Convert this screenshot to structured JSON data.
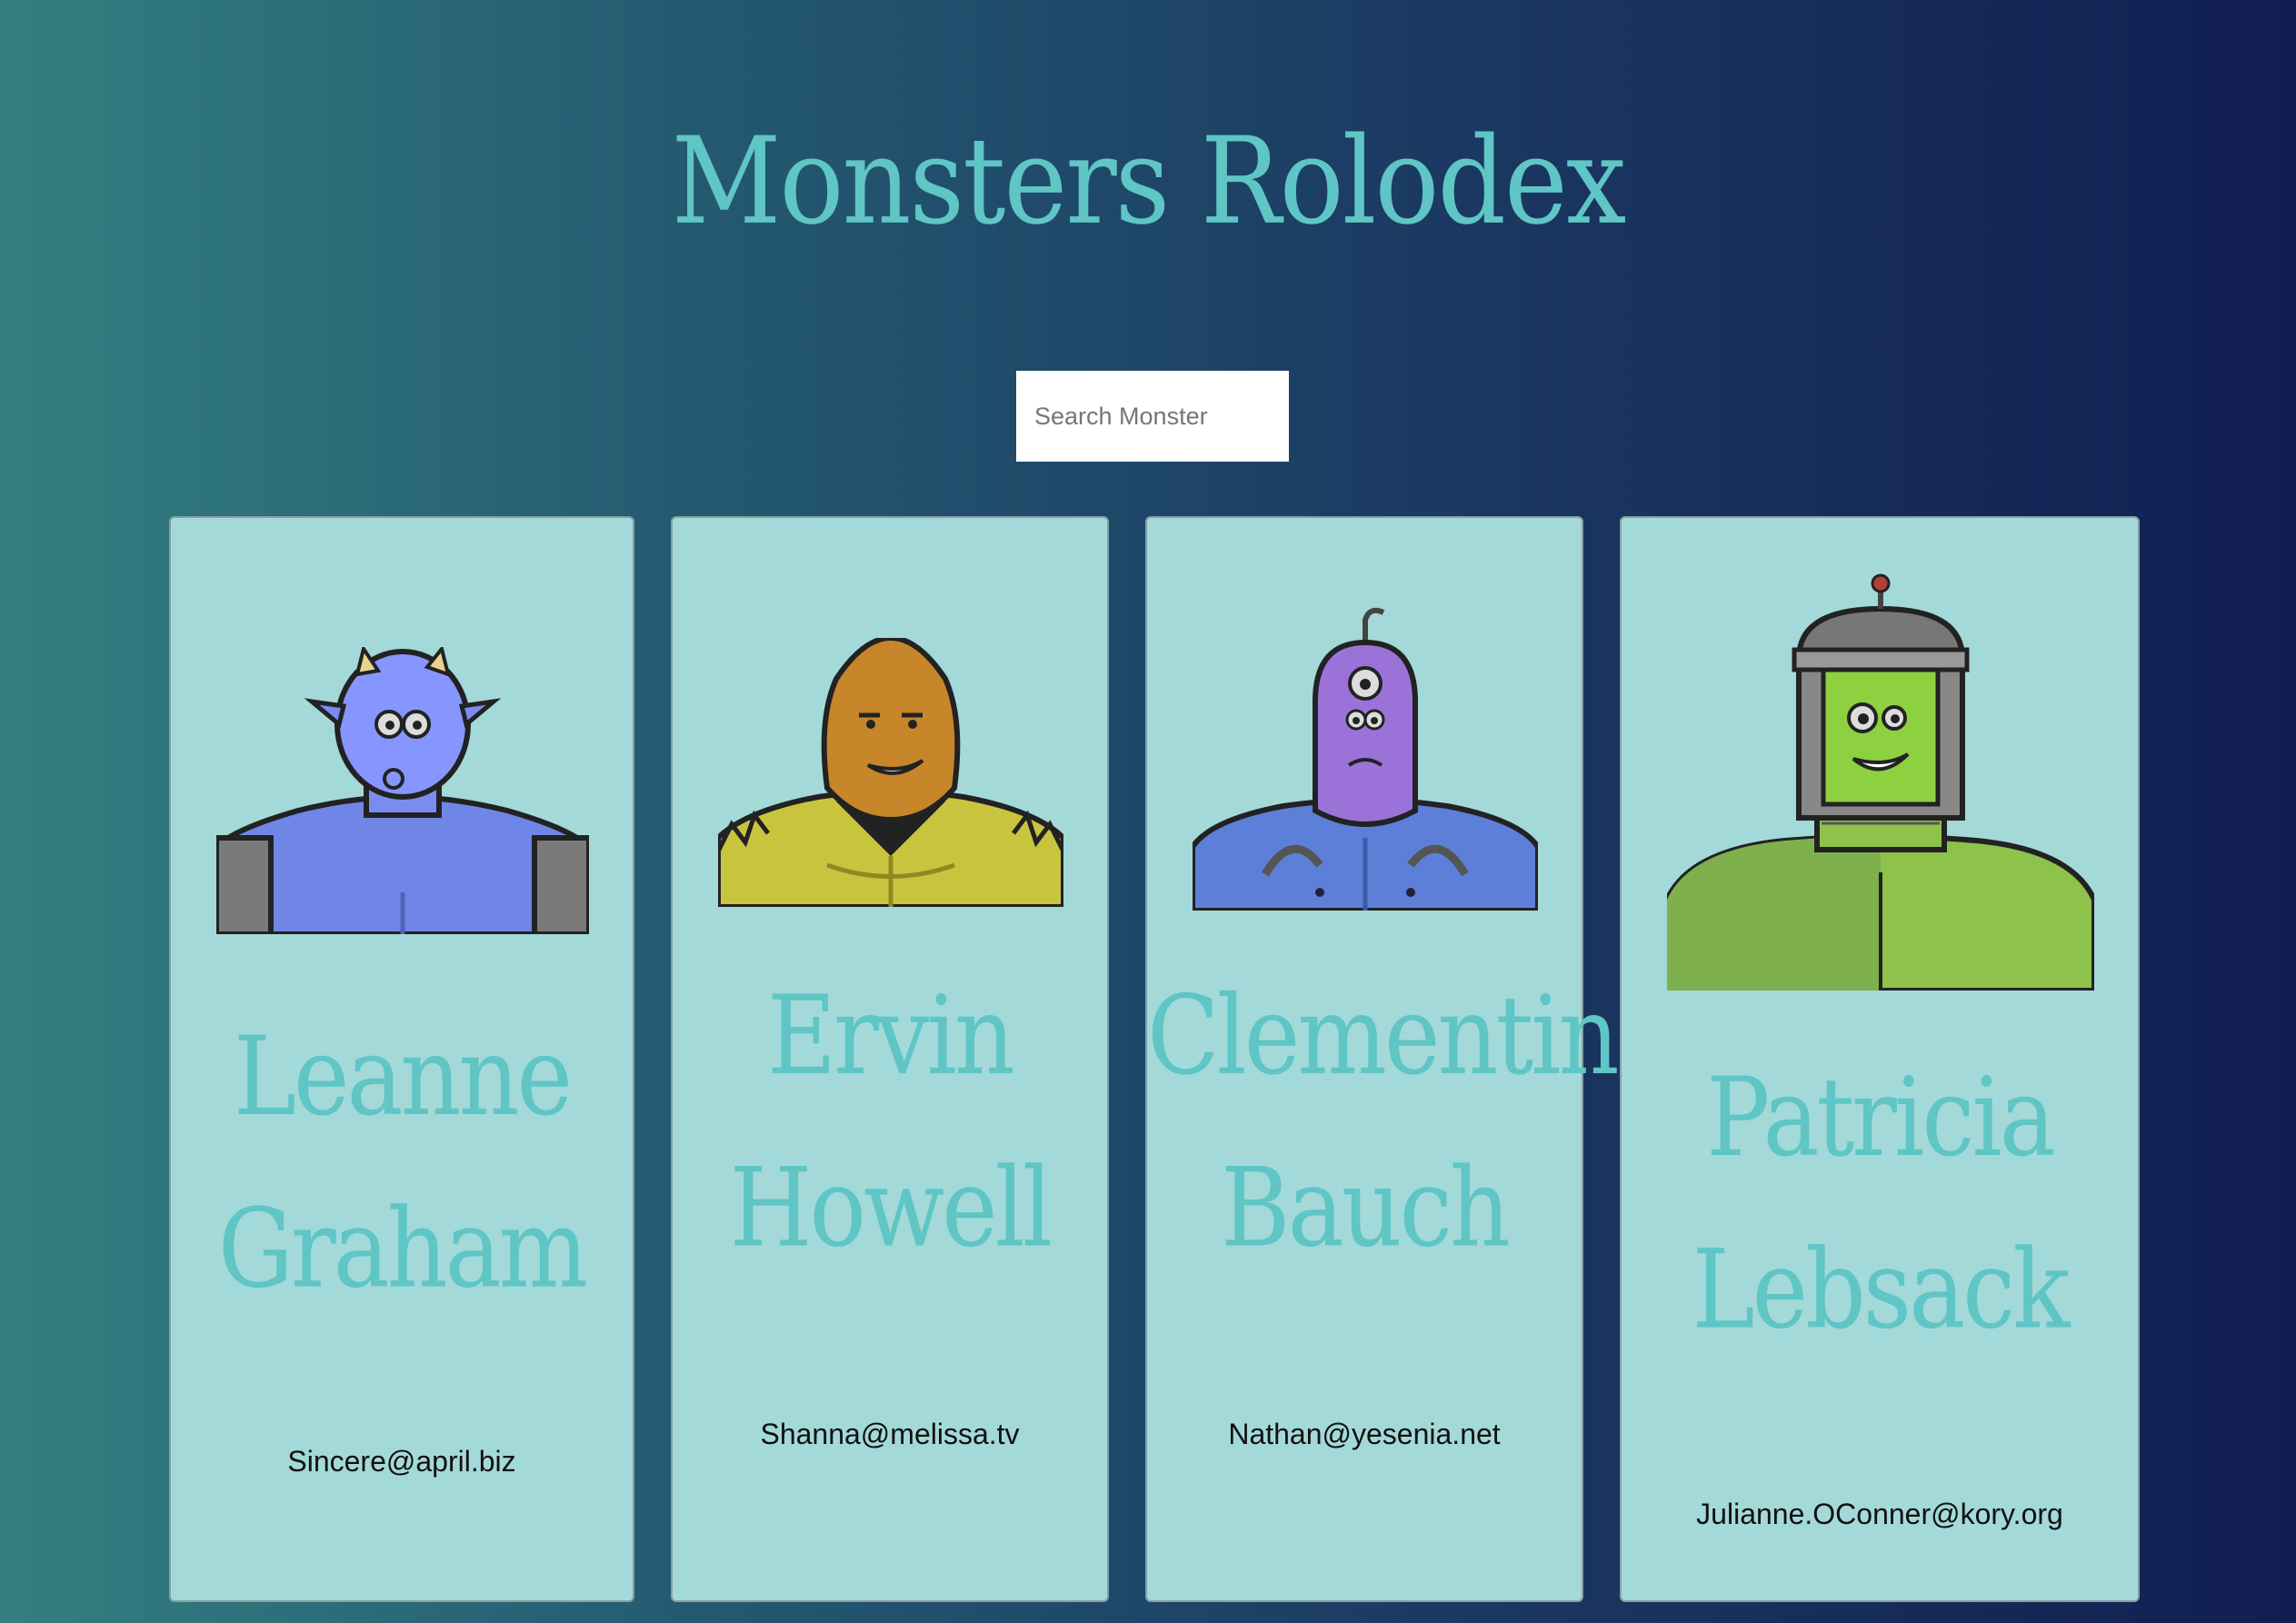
{
  "app": {
    "title": "Monsters Rolodex"
  },
  "search": {
    "placeholder": "Search Monster",
    "value": ""
  },
  "monsters": [
    {
      "name": "Leanne Graham",
      "email": "Sincere@april.biz"
    },
    {
      "name": "Ervin Howell",
      "email": "Shanna@melissa.tv"
    },
    {
      "name": "Clementine Bauch",
      "email": "Nathan@yesenia.net"
    },
    {
      "name": "Patricia Lebsack",
      "email": "Julianne.OConner@kory.org"
    }
  ],
  "colors": {
    "background_start": "#337f80",
    "background_end": "#111e52",
    "card": "#a3d9d9",
    "accent": "#5fc5c5"
  }
}
